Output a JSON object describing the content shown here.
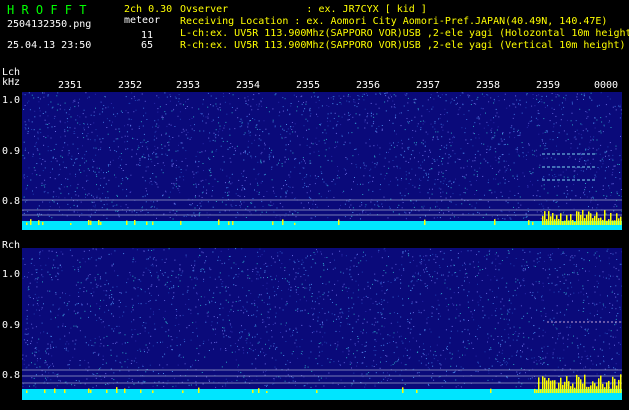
{
  "header": {
    "app_title": "H R O F F T",
    "version": "2ch 0.30",
    "file_name": "2504132350.png",
    "meteor_label": "meteor",
    "datetime": "25.04.13 23:50",
    "lch_count": "11",
    "rch_count": "65",
    "observer_line": "Ovserver             : ex. JR7CYX [ kid ]",
    "location_line": "Receiving Location : ex. Aomori City Aomori-Pref.JAPAN(40.49N, 140.47E)",
    "lch_line": "L-ch:ex. UV5R 113.900Mhz(SAPPORO VOR)USB ,2-ele yagi (Holozontal 10m height)",
    "rch_line": "R-ch:ex. UV5R 113.900Mhz(SAPPORO VOR)USB ,2-ele yagi (Vertical 10m height)"
  },
  "time_axis": [
    "2351",
    "2352",
    "2353",
    "2354",
    "2355",
    "2356",
    "2357",
    "2358",
    "2359",
    "0000"
  ],
  "lch": {
    "label": "Lch",
    "unit": "kHz",
    "ticks": [
      "1.0",
      "0.9",
      "0.8"
    ]
  },
  "rch": {
    "label": "Rch",
    "ticks": [
      "1.0",
      "0.9",
      "0.8"
    ]
  },
  "colors": {
    "background": "#000000",
    "spectrogram_base": "#0a0a7a",
    "noise_floor": "#00e5ff",
    "signal_burst": "#ffff00",
    "label_yellow": "#ffff00",
    "title_green": "#00ff00"
  }
}
